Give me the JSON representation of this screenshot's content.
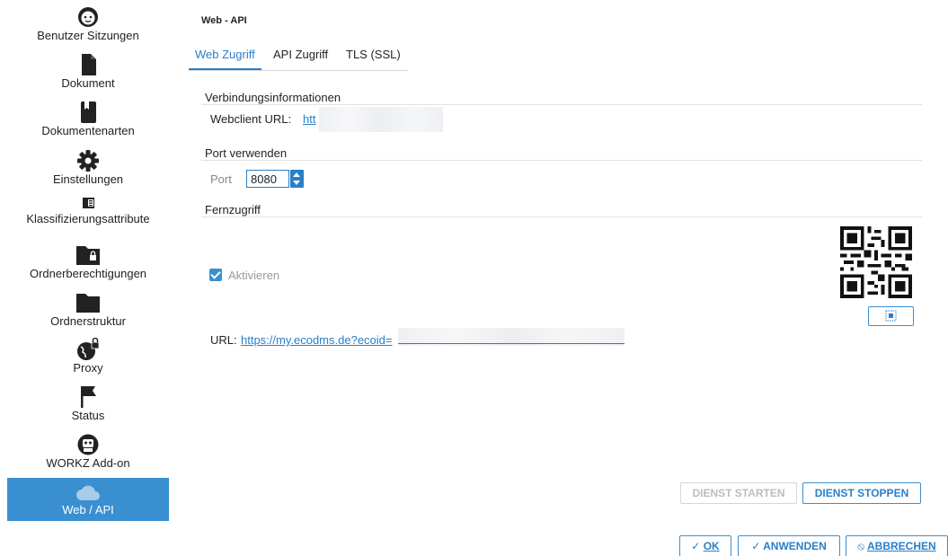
{
  "sidebar": {
    "items": [
      {
        "label": "Benutzer Sitzungen",
        "icon": "face-icon"
      },
      {
        "label": "Dokument",
        "icon": "document-icon"
      },
      {
        "label": "Dokumentenarten",
        "icon": "bookmark-icon"
      },
      {
        "label": "Einstellungen",
        "icon": "gear-icon"
      },
      {
        "label": "Klassifizierungsattribute",
        "icon": "list-card-icon"
      },
      {
        "label": "Ordnerberechtigungen",
        "icon": "folder-lock-icon"
      },
      {
        "label": "Ordnerstruktur",
        "icon": "folder-icon"
      },
      {
        "label": "Proxy",
        "icon": "globe-lock-icon"
      },
      {
        "label": "Status",
        "icon": "flag-icon"
      },
      {
        "label": "WORKZ Add-on",
        "icon": "robot-icon"
      },
      {
        "label": "Web / API",
        "icon": "cloud-icon"
      }
    ],
    "active": "Web / API"
  },
  "page": {
    "title": "Web - API"
  },
  "tabs": [
    {
      "label": "Web Zugriff",
      "active": true
    },
    {
      "label": "API Zugriff",
      "active": false
    },
    {
      "label": "TLS (SSL)",
      "active": false
    }
  ],
  "connection": {
    "section_title": "Verbindungsinformationen",
    "webclient_label": "Webclient URL:",
    "webclient_url": "htt"
  },
  "port": {
    "section_title": "Port verwenden",
    "label": "Port",
    "value": "8080"
  },
  "remote": {
    "section_title": "Fernzugriff",
    "activate_label": "Aktivieren",
    "activate_checked": true,
    "url_label": "URL:",
    "url_value": "https://my.ecodms.de?ecoid="
  },
  "service": {
    "start_label": "DIENST STARTEN",
    "stop_label": "DIENST STOPPEN"
  },
  "footer": {
    "ok_label": "OK",
    "apply_label": "ANWENDEN",
    "cancel_label": "ABBRECHEN"
  },
  "colors": {
    "accent": "#2a7fc7",
    "active_sidebar": "#3a8fd0",
    "disabled": "#bdbdbd"
  }
}
